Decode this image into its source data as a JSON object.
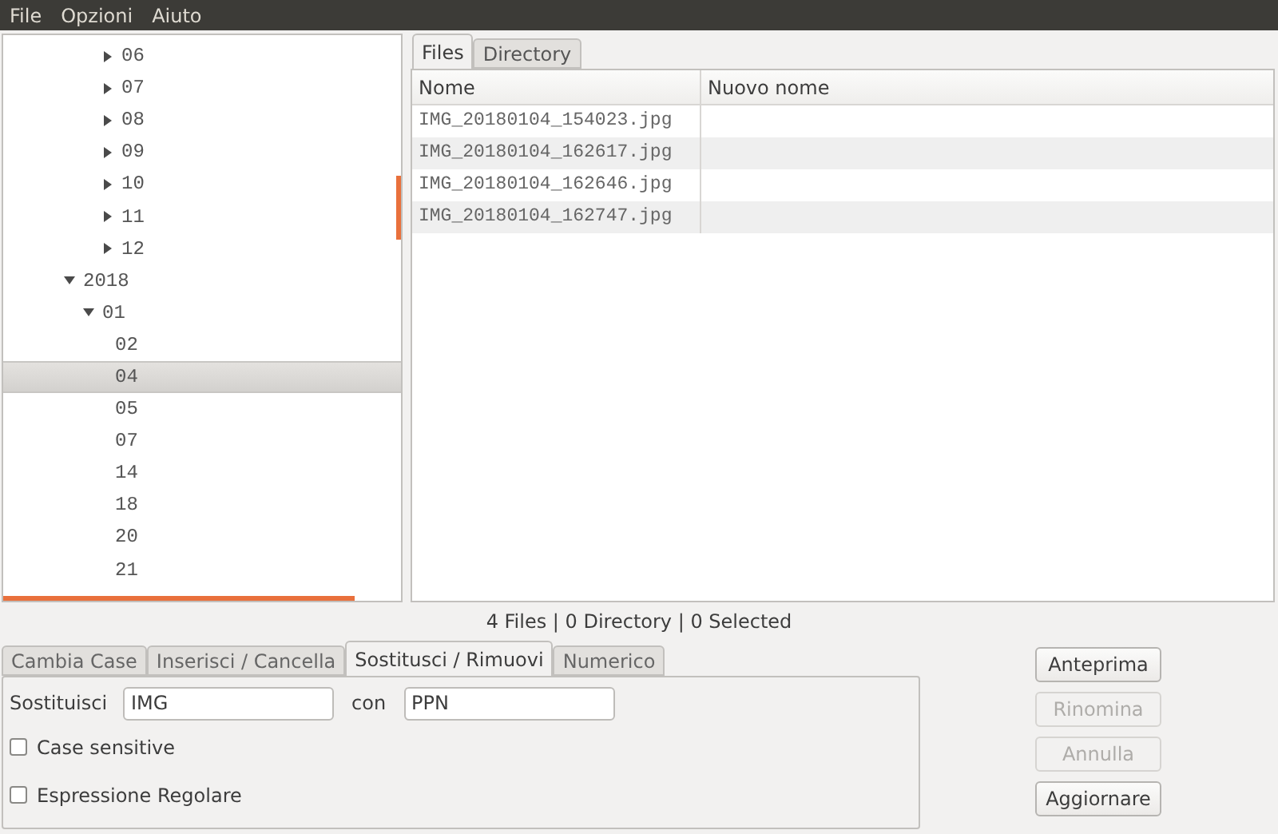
{
  "menu": [
    "File",
    "Opzioni",
    "Aiuto"
  ],
  "tree": [
    {
      "children": [
        {
          "label": "06",
          "expanded": false,
          "selected": false
        },
        {
          "label": "07",
          "expanded": false,
          "selected": false
        },
        {
          "label": "08",
          "expanded": false,
          "selected": false
        },
        {
          "label": "09",
          "expanded": false,
          "selected": false
        },
        {
          "label": "10",
          "expanded": false,
          "selected": false
        },
        {
          "label": "11",
          "expanded": false,
          "selected": false
        },
        {
          "label": "12",
          "expanded": false,
          "selected": false
        }
      ]
    },
    {
      "label": "2018",
      "expanded": true,
      "selected": false,
      "children": [
        {
          "label": "01",
          "expanded": true,
          "selected": false,
          "children": [
            {
              "label": "02",
              "selected": false
            },
            {
              "label": "04",
              "selected": true
            },
            {
              "label": "05",
              "selected": false
            },
            {
              "label": "07",
              "selected": false
            },
            {
              "label": "14",
              "selected": false
            },
            {
              "label": "18",
              "selected": false
            },
            {
              "label": "20",
              "selected": false
            },
            {
              "label": "21",
              "selected": false
            }
          ]
        }
      ]
    }
  ],
  "view_tabs": [
    {
      "label": "Files",
      "selected": true
    },
    {
      "label": "Directory",
      "selected": false
    }
  ],
  "table": {
    "columns": [
      "Nome",
      "Nuovo nome"
    ],
    "rows": [
      {
        "nome": "IMG_20180104_154023.jpg"
      },
      {
        "nome": "IMG_20180104_162617.jpg"
      },
      {
        "nome": "IMG_20180104_162646.jpg"
      },
      {
        "nome": "IMG_20180104_162747.jpg"
      }
    ]
  },
  "status": "4 Files | 0 Directory | 0 Selected",
  "edit_tabs": [
    {
      "label": "Cambia Case",
      "selected": false
    },
    {
      "label": "Inserisci / Cancella",
      "selected": false
    },
    {
      "label": "Sostitusci / Rimuovi",
      "selected": true
    },
    {
      "label": "Numerico",
      "selected": false
    }
  ],
  "replace": {
    "label": "Sostituisci",
    "value": "IMG",
    "with_label": "con",
    "with_value": "PPN"
  },
  "options": [
    {
      "label": "Case sensitive",
      "checked": false
    },
    {
      "label": "Espressione Regolare",
      "checked": false
    }
  ],
  "buttons": [
    {
      "label": "Anteprima",
      "disabled": false
    },
    {
      "label": "Rinomina",
      "disabled": true
    },
    {
      "label": "Annulla",
      "disabled": true
    },
    {
      "label": "Aggiornare",
      "disabled": false
    }
  ]
}
